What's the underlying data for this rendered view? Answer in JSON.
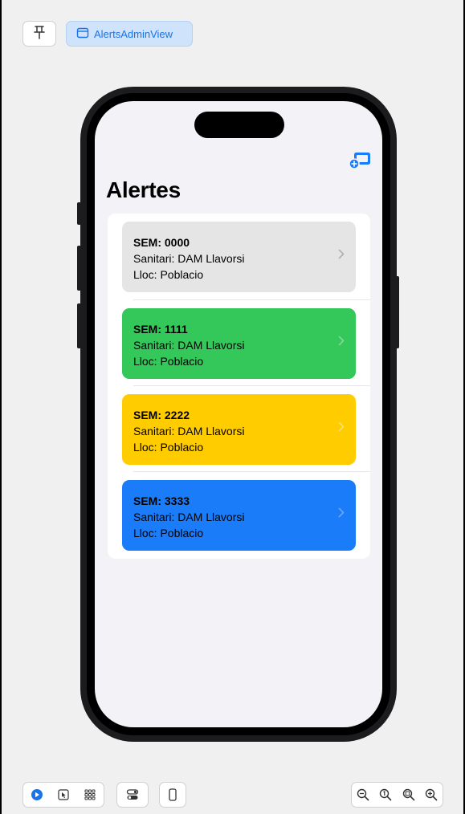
{
  "toolbar": {
    "pin_icon": "pin-icon",
    "view_label": "AlertsAdminView",
    "view_icon": "window-icon"
  },
  "screen": {
    "title": "Alertes",
    "add_icon": "display-add-icon",
    "accent": "#1a73e8",
    "alerts": [
      {
        "sem": "SEM: 0000",
        "sanitari": "Sanitari: DAM Llavorsi",
        "lloc": "Lloc: Poblacio",
        "color": "#e5e5e5"
      },
      {
        "sem": "SEM: 1111",
        "sanitari": "Sanitari: DAM Llavorsi",
        "lloc": "Lloc: Poblacio",
        "color": "#34c759"
      },
      {
        "sem": "SEM: 2222",
        "sanitari": "Sanitari: DAM Llavorsi",
        "lloc": "Lloc: Poblacio",
        "color": "#ffcc00"
      },
      {
        "sem": "SEM: 3333",
        "sanitari": "Sanitari: DAM Llavorsi",
        "lloc": "Lloc: Poblacio",
        "color": "#1a7cf9"
      }
    ]
  },
  "bottom_toolbar": {
    "left_icons": [
      "live-preview-icon",
      "selectable-icon",
      "variants-icon"
    ],
    "middle_icons": [
      "device-settings-icon",
      "device-icon"
    ],
    "zoom_icons": [
      "zoom-out-icon",
      "zoom-100-icon",
      "zoom-to-fit-icon",
      "zoom-in-icon"
    ]
  }
}
